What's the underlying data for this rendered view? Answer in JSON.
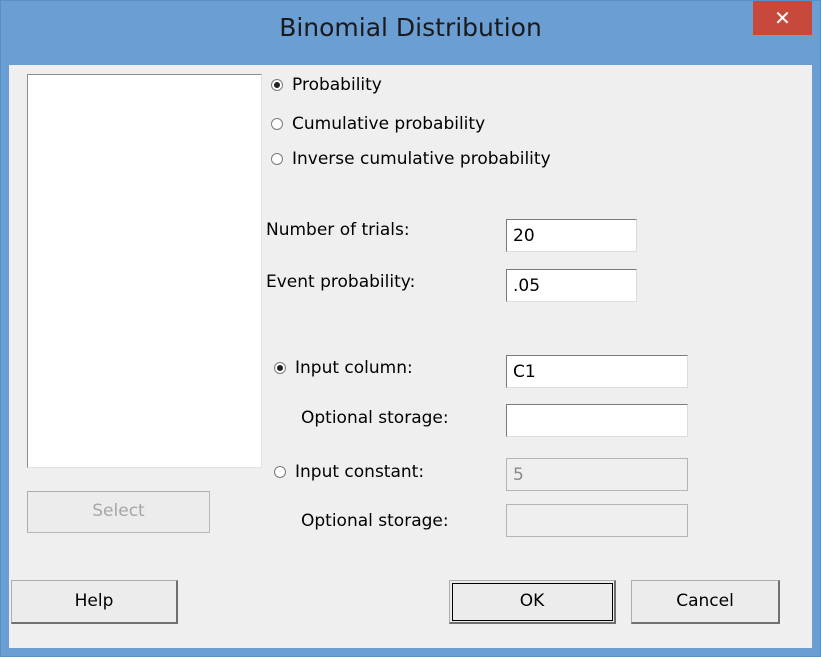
{
  "window": {
    "title": "Binomial Distribution",
    "close_label": "✕"
  },
  "mode": {
    "options": [
      {
        "label": "Probability",
        "selected": true
      },
      {
        "label": "Cumulative probability",
        "selected": false
      },
      {
        "label": "Inverse cumulative probability",
        "selected": false
      }
    ]
  },
  "params": {
    "trials_label": "Number of trials:",
    "trials_value": "20",
    "event_prob_label": "Event probability:",
    "event_prob_value": ".05"
  },
  "input": {
    "column_label": "Input column:",
    "column_value": "C1",
    "column_selected": true,
    "column_storage_label": "Optional storage:",
    "column_storage_value": "",
    "constant_label": "Input constant:",
    "constant_value": "5",
    "constant_selected": false,
    "constant_storage_label": "Optional storage:",
    "constant_storage_value": ""
  },
  "buttons": {
    "select": "Select",
    "help": "Help",
    "ok": "OK",
    "cancel": "Cancel"
  }
}
